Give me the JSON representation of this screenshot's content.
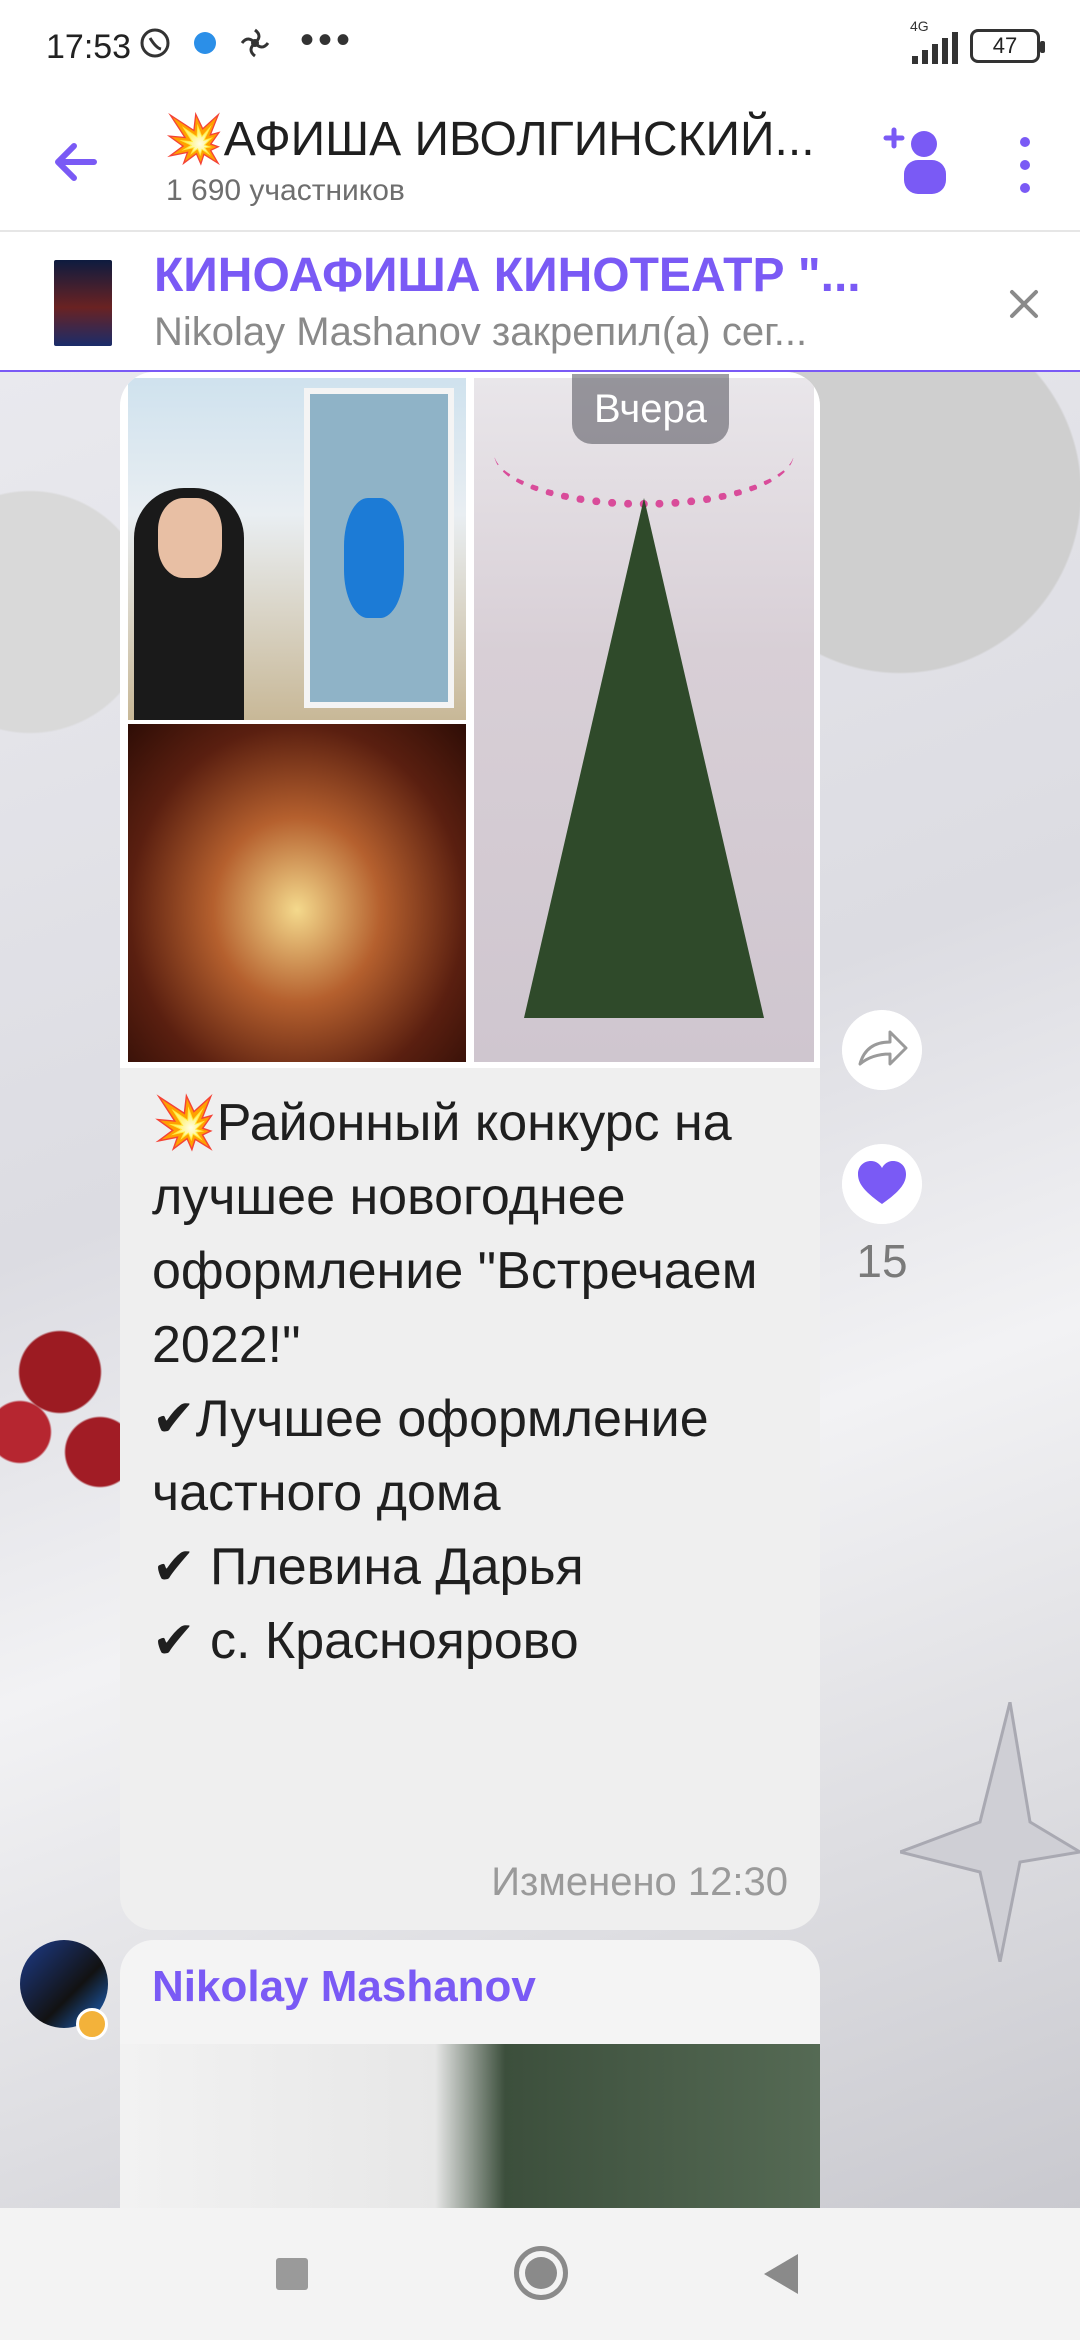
{
  "status_bar": {
    "time": "17:53",
    "network": "4G",
    "battery": "47",
    "more": "•••"
  },
  "header": {
    "title": "💥АФИША ИВОЛГИНСКИЙ...",
    "subtitle": "1 690 участников"
  },
  "pinned": {
    "title": "КИНОАФИША КИНОТЕАТР \"...",
    "subtitle": "Nikolay Mashanov закрепил(а) сег..."
  },
  "message": {
    "date_chip": "Вчера",
    "text": "💥Районный конкурс на лучшее новогоднее оформление \"Встречаем 2022!\"\n✔Лучшее оформление частного дома\n✔ Плевина Дарья\n✔ с. Краснoярово",
    "edited_time": "Изменено 12:30",
    "likes": "15"
  },
  "next_message": {
    "sender": "Nikolay Mashanov"
  },
  "colors": {
    "accent": "#7a5af5",
    "bubble": "#efefef"
  },
  "icons": {
    "back": "arrow-left-icon",
    "add_member": "add-member-icon",
    "more": "more-vertical-icon",
    "close": "close-icon",
    "share": "share-icon",
    "like": "heart-icon"
  }
}
